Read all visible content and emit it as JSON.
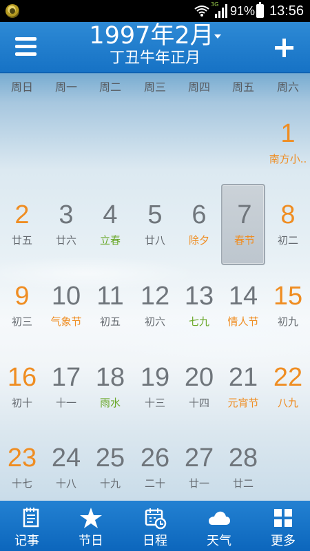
{
  "status_bar": {
    "network_label": "3G",
    "battery_percent": "91%",
    "time": "13:56",
    "icons": [
      "app-notification-icon",
      "wifi-icon",
      "signal-icon",
      "battery-icon"
    ]
  },
  "header": {
    "title": "1997年2月",
    "subtitle": "丁丑牛年正月",
    "icons": [
      "menu-icon",
      "dropdown-icon",
      "plus-icon"
    ]
  },
  "calendar": {
    "weekdays": [
      "周日",
      "周一",
      "周二",
      "周三",
      "周四",
      "周五",
      "周六"
    ],
    "days": [
      {
        "day": "1",
        "label": "南方小..",
        "weekday_index": 6,
        "row": 0,
        "type": "weekend"
      },
      {
        "day": "2",
        "label": "廿五",
        "weekday_index": 0,
        "row": 1,
        "type": "weekend-plain"
      },
      {
        "day": "3",
        "label": "廿六",
        "weekday_index": 1,
        "row": 1,
        "type": "normal"
      },
      {
        "day": "4",
        "label": "立春",
        "weekday_index": 2,
        "row": 1,
        "type": "term"
      },
      {
        "day": "5",
        "label": "廿八",
        "weekday_index": 3,
        "row": 1,
        "type": "normal"
      },
      {
        "day": "6",
        "label": "除夕",
        "weekday_index": 4,
        "row": 1,
        "type": "festival"
      },
      {
        "day": "7",
        "label": "春节",
        "weekday_index": 5,
        "row": 1,
        "type": "festival",
        "selected": true
      },
      {
        "day": "8",
        "label": "初二",
        "weekday_index": 6,
        "row": 1,
        "type": "weekend-plain"
      },
      {
        "day": "9",
        "label": "初三",
        "weekday_index": 0,
        "row": 2,
        "type": "weekend-plain"
      },
      {
        "day": "10",
        "label": "气象节",
        "weekday_index": 1,
        "row": 2,
        "type": "festival"
      },
      {
        "day": "11",
        "label": "初五",
        "weekday_index": 2,
        "row": 2,
        "type": "normal"
      },
      {
        "day": "12",
        "label": "初六",
        "weekday_index": 3,
        "row": 2,
        "type": "normal"
      },
      {
        "day": "13",
        "label": "七九",
        "weekday_index": 4,
        "row": 2,
        "type": "term"
      },
      {
        "day": "14",
        "label": "情人节",
        "weekday_index": 5,
        "row": 2,
        "type": "festival"
      },
      {
        "day": "15",
        "label": "初九",
        "weekday_index": 6,
        "row": 2,
        "type": "weekend-plain"
      },
      {
        "day": "16",
        "label": "初十",
        "weekday_index": 0,
        "row": 3,
        "type": "weekend-plain"
      },
      {
        "day": "17",
        "label": "十一",
        "weekday_index": 1,
        "row": 3,
        "type": "normal"
      },
      {
        "day": "18",
        "label": "雨水",
        "weekday_index": 2,
        "row": 3,
        "type": "term"
      },
      {
        "day": "19",
        "label": "十三",
        "weekday_index": 3,
        "row": 3,
        "type": "normal"
      },
      {
        "day": "20",
        "label": "十四",
        "weekday_index": 4,
        "row": 3,
        "type": "normal"
      },
      {
        "day": "21",
        "label": "元宵节",
        "weekday_index": 5,
        "row": 3,
        "type": "festival"
      },
      {
        "day": "22",
        "label": "八九",
        "weekday_index": 6,
        "row": 3,
        "type": "weekend-term"
      },
      {
        "day": "23",
        "label": "十七",
        "weekday_index": 0,
        "row": 4,
        "type": "weekend-plain"
      },
      {
        "day": "24",
        "label": "十八",
        "weekday_index": 1,
        "row": 4,
        "type": "normal"
      },
      {
        "day": "25",
        "label": "十九",
        "weekday_index": 2,
        "row": 4,
        "type": "normal"
      },
      {
        "day": "26",
        "label": "二十",
        "weekday_index": 3,
        "row": 4,
        "type": "normal"
      },
      {
        "day": "27",
        "label": "廿一",
        "weekday_index": 4,
        "row": 4,
        "type": "normal"
      },
      {
        "day": "28",
        "label": "廿二",
        "weekday_index": 5,
        "row": 4,
        "type": "normal"
      }
    ],
    "colors": {
      "weekend": "#ef8d22",
      "solar_term": "#6aa82a",
      "normal": "#6f757b",
      "header_blue": "#1672c5"
    }
  },
  "bottom_tabs": [
    {
      "label": "记事",
      "icon": "notes-icon"
    },
    {
      "label": "节日",
      "icon": "star-icon"
    },
    {
      "label": "日程",
      "icon": "calendar-clock-icon"
    },
    {
      "label": "天气",
      "icon": "cloud-icon"
    },
    {
      "label": "更多",
      "icon": "grid-icon"
    }
  ]
}
